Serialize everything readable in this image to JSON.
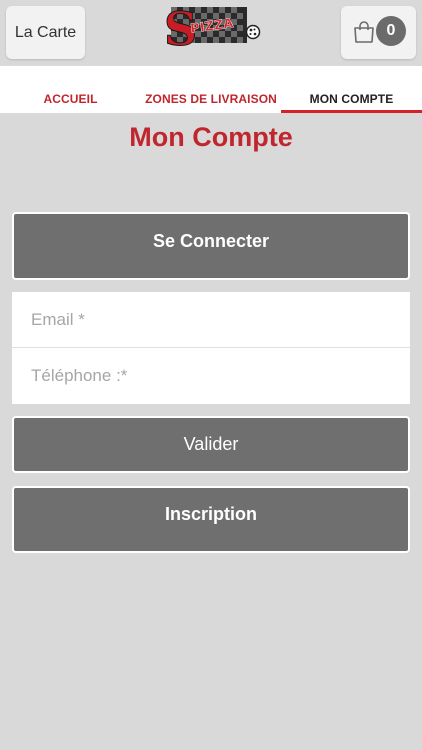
{
  "header": {
    "menu_label": "La Carte",
    "logo_text": "SPIZZA",
    "cart_count": "0"
  },
  "tabs": [
    {
      "label": "ACCUEIL",
      "active": false
    },
    {
      "label": "ZONES DE LIVRAISON",
      "active": false
    },
    {
      "label": "MON COMPTE",
      "active": true
    }
  ],
  "page": {
    "title": "Mon Compte",
    "login_button": "Se Connecter",
    "email_placeholder": "Email *",
    "phone_placeholder": "Téléphone :*",
    "validate_button": "Valider",
    "register_button": "Inscription"
  },
  "colors": {
    "accent": "#c0262d",
    "button_bg": "#6f6f6f",
    "background": "#d9d9d9"
  },
  "icons": {
    "cart": "shopping-bag-icon"
  }
}
